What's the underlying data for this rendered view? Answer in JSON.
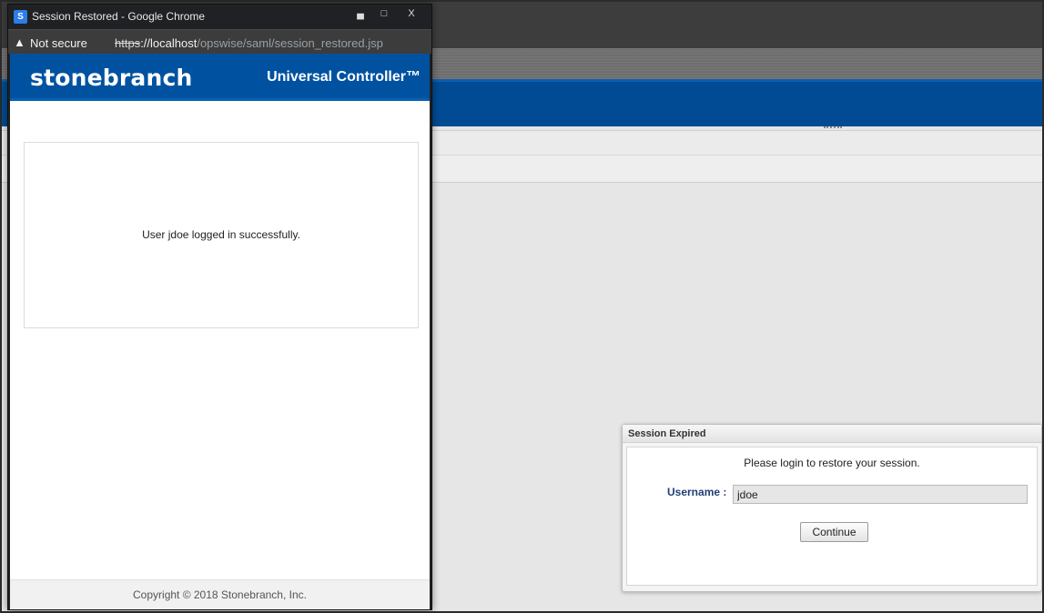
{
  "popup": {
    "favicon_letter": "S",
    "window_title": "Session Restored - Google Chrome",
    "controls": {
      "minimize": "▄",
      "maximize": "□",
      "close": "X"
    },
    "address": {
      "security_label": "Not secure",
      "scheme": "https",
      "host": "://localhost",
      "path": "/opswise/saml/session_restored.jsp"
    },
    "brand": "stonebranch",
    "product": "Universal Controller™",
    "message": "User jdoe logged in successfully.",
    "footer": "Copyright © 2018 Stonebranch, Inc."
  },
  "session_dialog": {
    "title": "Session Expired",
    "message": "Please login to restore your session.",
    "username_label": "Username :",
    "username_value": "jdoe",
    "continue_label": "Continue"
  },
  "colors": {
    "brand_blue": "#0052a0",
    "chrome_dark": "#202124",
    "link_label": "#1f3f74"
  },
  "icons": [
    "warning-icon",
    "stonebranch-favicon"
  ]
}
